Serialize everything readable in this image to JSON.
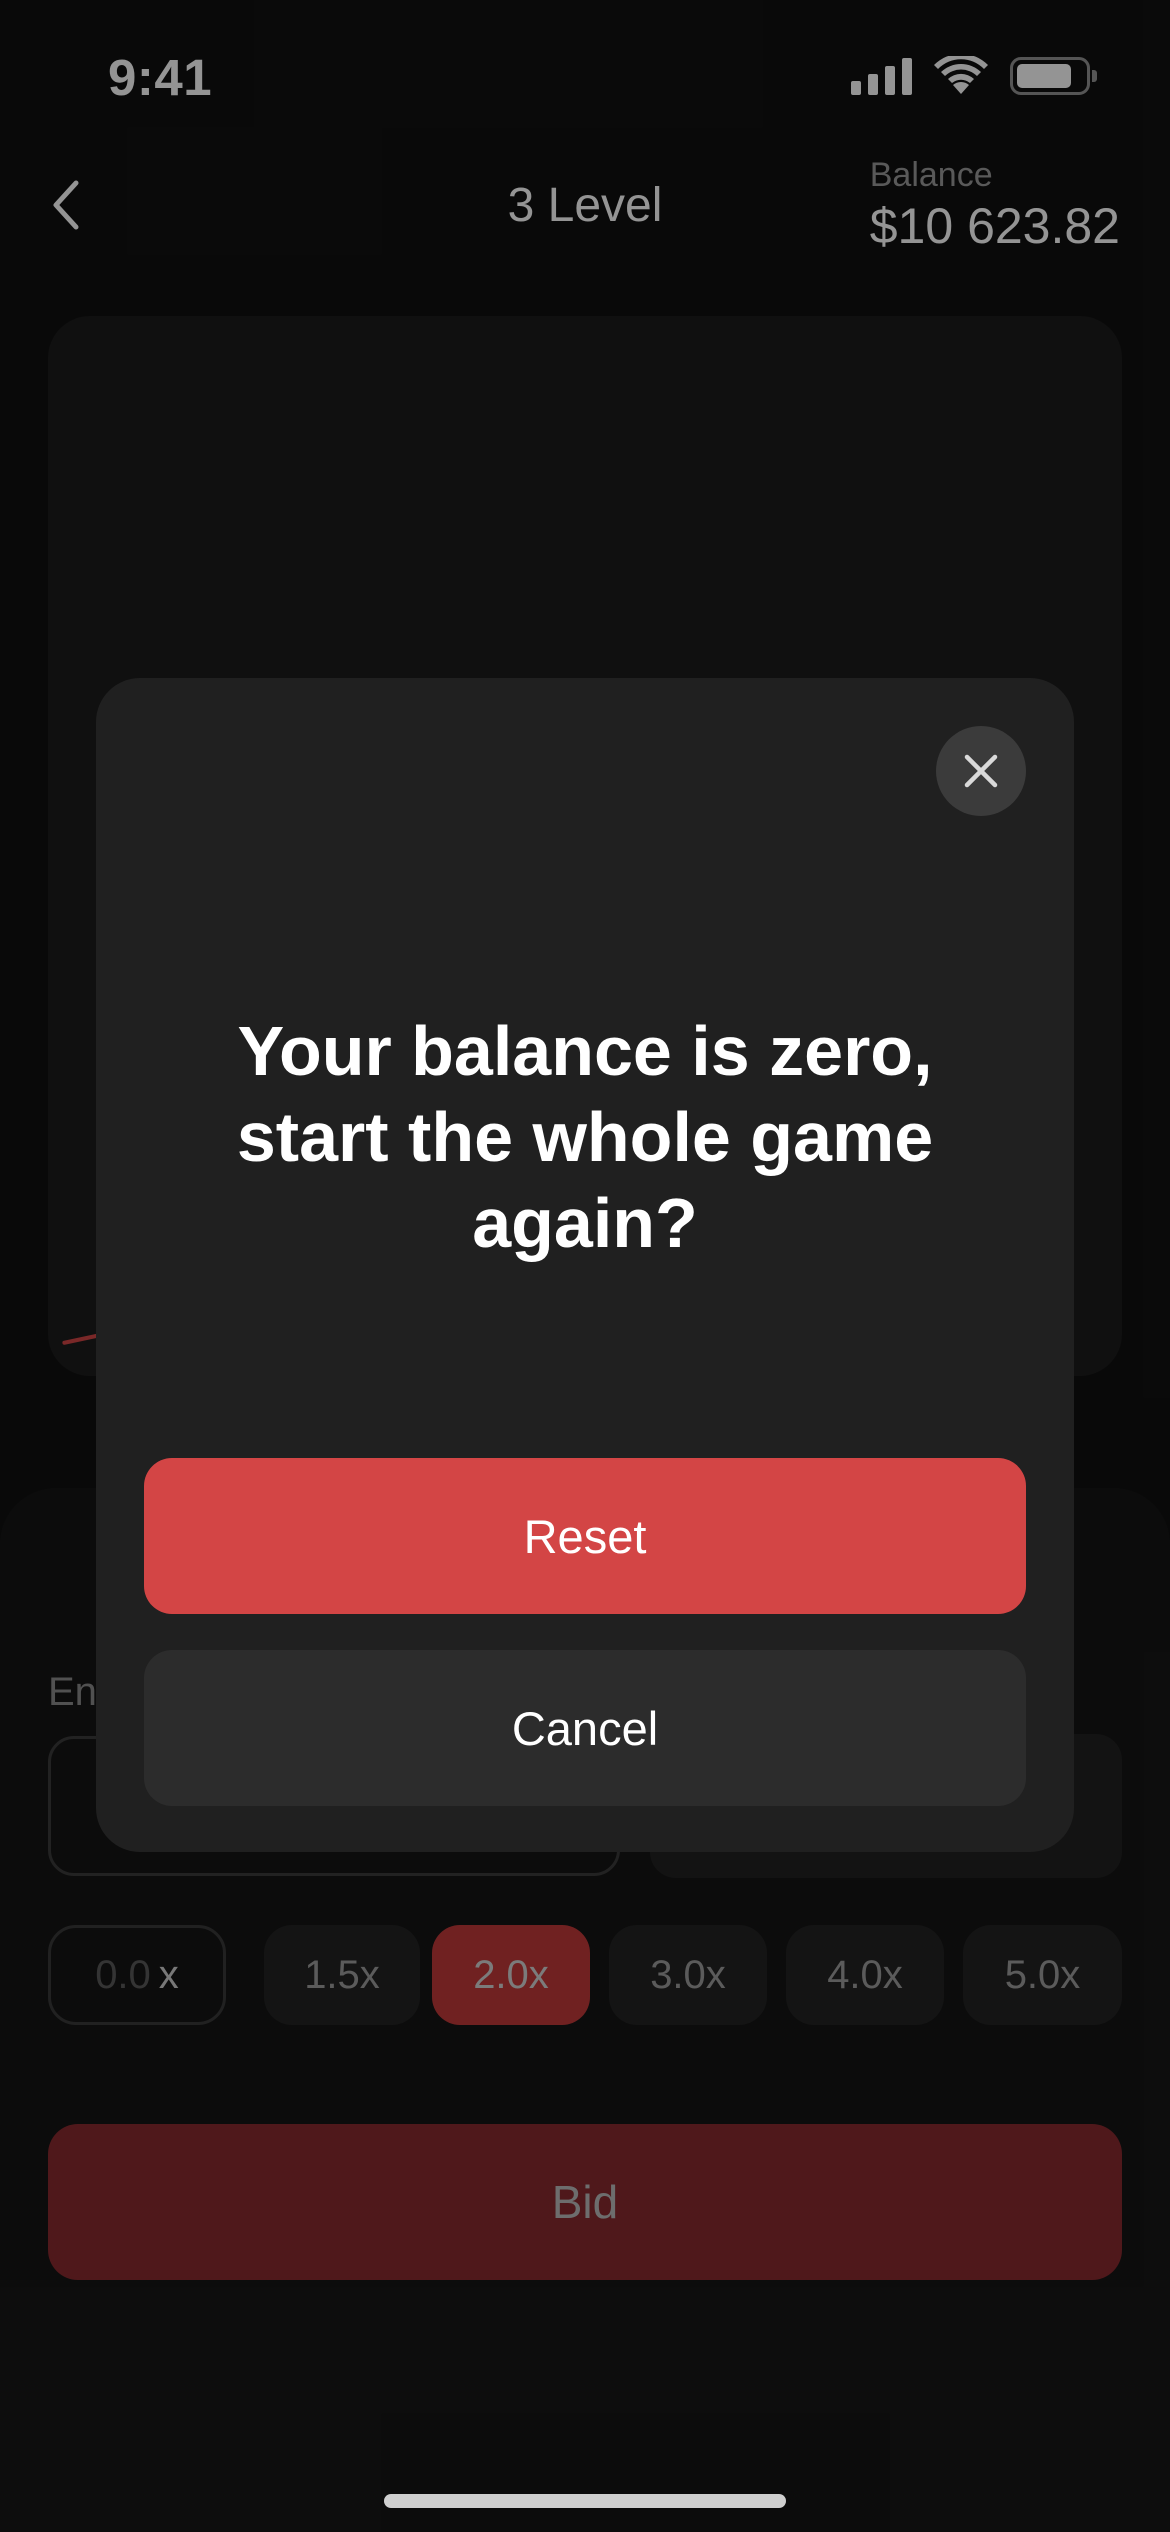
{
  "status_bar": {
    "time": "9:41",
    "icons": [
      "signal-icon",
      "wifi-icon",
      "battery-icon"
    ]
  },
  "header": {
    "back_icon": "chevron-left-icon",
    "title": "3 Level",
    "balance_label": "Balance",
    "balance_value": "$10 623.82"
  },
  "controls": {
    "enter_label": "En",
    "custom_multiplier_placeholder": "0.0",
    "custom_multiplier_suffix": "x",
    "multipliers": [
      {
        "label": "1.5x",
        "selected": false
      },
      {
        "label": "2.0x",
        "selected": true
      },
      {
        "label": "3.0x",
        "selected": false
      },
      {
        "label": "4.0x",
        "selected": false
      },
      {
        "label": "5.0x",
        "selected": false
      }
    ],
    "bid_label": "Bid"
  },
  "modal": {
    "close_icon": "close-icon",
    "message": "Your balance is zero, start the whole game again?",
    "reset_label": "Reset",
    "cancel_label": "Cancel"
  },
  "colors": {
    "accent": "#d34545",
    "accent_dimmed": "#882a2f",
    "background": "#111111",
    "modal_background": "#202020"
  }
}
